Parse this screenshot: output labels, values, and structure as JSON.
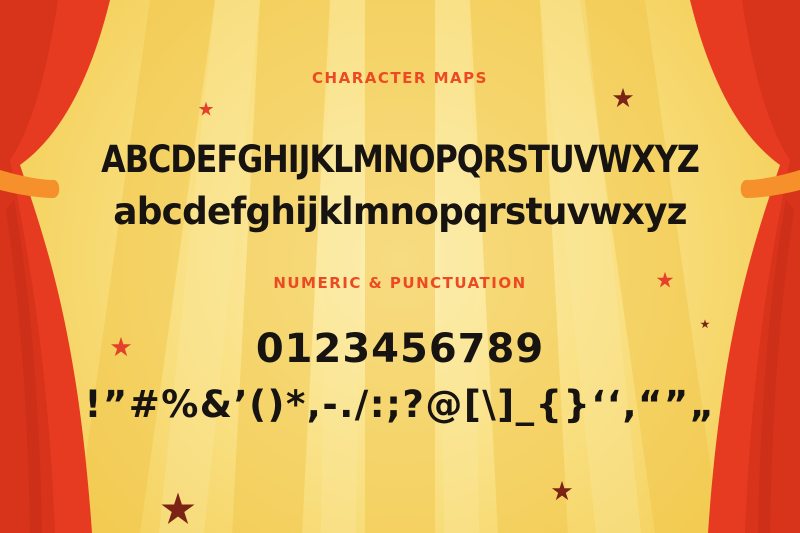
{
  "headings": {
    "character_maps": "CHARACTER MAPS",
    "numeric_punctuation": "NUMERIC & PUNCTUATION"
  },
  "glyphs": {
    "uppercase": "ABCDEFGHIJKLMNOPQRSTUVWXYZ",
    "lowercase": "abcdefghijklmnopqrstuvwxyz",
    "digits": "0123456789",
    "punctuation": "!”#%&’()*,-./:;?@[\\]_{}‘‘,“”„"
  },
  "colors": {
    "background_light": "#fbe9a0",
    "background_mid": "#f7d766",
    "ray_dark": "#f1c446",
    "heading": "#ec4a23",
    "text": "#161310",
    "curtain_red": "#e63b21",
    "curtain_shadow": "#c62c17",
    "curtain_tie": "#f5902a",
    "star_red": "#e5402a",
    "star_dark": "#7b2416"
  }
}
